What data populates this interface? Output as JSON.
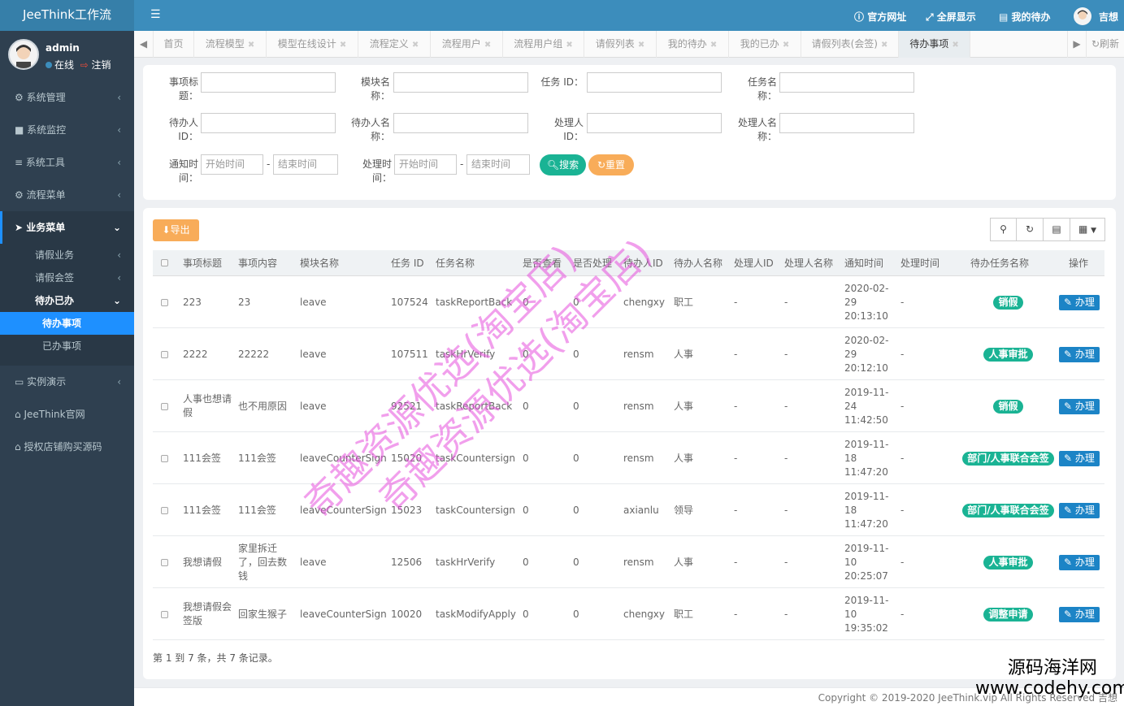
{
  "app": {
    "logo": "JeeThink工作流"
  },
  "user": {
    "name": "admin",
    "status": "在线",
    "logout": "注销"
  },
  "sidebar": {
    "menus": [
      "系统管理",
      "系统监控",
      "系统工具",
      "流程菜单"
    ],
    "biz": {
      "title": "业务菜单",
      "items": [
        "请假业务",
        "请假会签"
      ],
      "todo": {
        "title": "待办已办",
        "items": [
          "待办事项",
          "已办事项"
        ]
      }
    },
    "extra": [
      "实例演示",
      "JeeThink官网",
      "授权店铺购买源码"
    ]
  },
  "header": {
    "links": [
      "官方网址",
      "全屏显示",
      "我的待办"
    ],
    "username": "吉想"
  },
  "tabs": {
    "items": [
      "首页",
      "流程模型",
      "模型在线设计",
      "流程定义",
      "流程用户",
      "流程用户组",
      "请假列表",
      "我的待办",
      "我的已办",
      "请假列表(会签)",
      "待办事项"
    ],
    "refresh": "刷新"
  },
  "search": {
    "labels": {
      "title": "事项标题：",
      "module": "模块名称：",
      "taskid": "任务 ID：",
      "taskname": "任务名称：",
      "todoid": "待办人ID：",
      "todoname": "待办人名称：",
      "handlerid": "处理人ID：",
      "handlername": "处理人名称：",
      "notify": "通知时间：",
      "handle": "处理时间："
    },
    "start_placeholder": "开始时间",
    "end_placeholder": "结束时间",
    "sep": "-",
    "search_btn": "搜索",
    "reset_btn": "重置"
  },
  "table": {
    "export": "导出",
    "headers": [
      "事项标题",
      "事项内容",
      "模块名称",
      "任务 ID",
      "任务名称",
      "是否查看",
      "是否处理",
      "待办人ID",
      "待办人名称",
      "处理人ID",
      "处理人名称",
      "通知时间",
      "处理时间",
      "待办任务名称",
      "操作"
    ],
    "action": "办理",
    "rows": [
      {
        "title": "223",
        "content": "23",
        "module": "leave",
        "taskid": "107524",
        "taskname": "taskReportBack",
        "viewed": "0",
        "handled": "0",
        "todoid": "chengxy",
        "todoname": "职工",
        "hid": "-",
        "hname": "-",
        "notify": "2020-02-29 20:13:10",
        "htime": "-",
        "badge": "销假"
      },
      {
        "title": "2222",
        "content": "22222",
        "module": "leave",
        "taskid": "107511",
        "taskname": "taskHrVerify",
        "viewed": "0",
        "handled": "0",
        "todoid": "rensm",
        "todoname": "人事",
        "hid": "-",
        "hname": "-",
        "notify": "2020-02-29 20:12:10",
        "htime": "-",
        "badge": "人事审批"
      },
      {
        "title": "人事也想请假",
        "content": "也不用原因",
        "module": "leave",
        "taskid": "92521",
        "taskname": "taskReportBack",
        "viewed": "0",
        "handled": "0",
        "todoid": "rensm",
        "todoname": "人事",
        "hid": "-",
        "hname": "-",
        "notify": "2019-11-24 11:42:50",
        "htime": "-",
        "badge": "销假"
      },
      {
        "title": "111会签",
        "content": "111会签",
        "module": "leaveCounterSign",
        "taskid": "15020",
        "taskname": "taskCountersign",
        "viewed": "0",
        "handled": "0",
        "todoid": "rensm",
        "todoname": "人事",
        "hid": "-",
        "hname": "-",
        "notify": "2019-11-18 11:47:20",
        "htime": "-",
        "badge": "部门/人事联合会签"
      },
      {
        "title": "111会签",
        "content": "111会签",
        "module": "leaveCounterSign",
        "taskid": "15023",
        "taskname": "taskCountersign",
        "viewed": "0",
        "handled": "0",
        "todoid": "axianlu",
        "todoname": "领导",
        "hid": "-",
        "hname": "-",
        "notify": "2019-11-18 11:47:20",
        "htime": "-",
        "badge": "部门/人事联合会签"
      },
      {
        "title": "我想请假",
        "content": "家里拆迁了，回去数钱",
        "module": "leave",
        "taskid": "12506",
        "taskname": "taskHrVerify",
        "viewed": "0",
        "handled": "0",
        "todoid": "rensm",
        "todoname": "人事",
        "hid": "-",
        "hname": "-",
        "notify": "2019-11-10 20:25:07",
        "htime": "-",
        "badge": "人事审批"
      },
      {
        "title": "我想请假会签版",
        "content": "回家生猴子",
        "module": "leaveCounterSign",
        "taskid": "10020",
        "taskname": "taskModifyApply",
        "viewed": "0",
        "handled": "0",
        "todoid": "chengxy",
        "todoname": "职工",
        "hid": "-",
        "hname": "-",
        "notify": "2019-11-10 19:35:02",
        "htime": "-",
        "badge": "调整申请"
      }
    ],
    "pageinfo": "第 1 到 7 条，共 7 条记录。"
  },
  "footer": {
    "copyright": "Copyright © 2019-2020 JeeThink.vip All Rights Reserved 吉想"
  },
  "watermark": {
    "line1": "奇趣资源优选(淘宝店)",
    "line2": "奇趣资源优选(淘宝店)"
  },
  "brand": {
    "name": "源码海洋网",
    "url": "www.codehy.com"
  },
  "colors": {
    "primary": "#3c8dbc",
    "sidebar": "#2f4050",
    "active": "#1e90ff",
    "green": "#1ab394",
    "orange": "#f8ac59",
    "blue": "#1c84c6"
  }
}
